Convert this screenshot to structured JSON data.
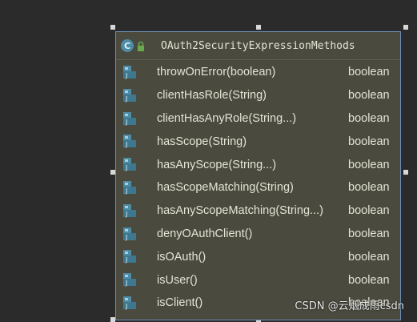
{
  "popup": {
    "title": "OAuth2SecurityExpressionMethods",
    "icons": {
      "class": "class-c-icon",
      "access": "lock-icon"
    },
    "class_icon_letter": "C",
    "method_icon": "method-j-icon",
    "methods": [
      {
        "name": "throwOnError(boolean)",
        "type": "boolean"
      },
      {
        "name": "clientHasRole(String)",
        "type": "boolean"
      },
      {
        "name": "clientHasAnyRole(String...)",
        "type": "boolean"
      },
      {
        "name": "hasScope(String)",
        "type": "boolean"
      },
      {
        "name": "hasAnyScope(String...)",
        "type": "boolean"
      },
      {
        "name": "hasScopeMatching(String)",
        "type": "boolean"
      },
      {
        "name": "hasAnyScopeMatching(String...)",
        "type": "boolean"
      },
      {
        "name": "denyOAuthClient()",
        "type": "boolean"
      },
      {
        "name": "isOAuth()",
        "type": "boolean"
      },
      {
        "name": "isUser()",
        "type": "boolean"
      },
      {
        "name": "isClient()",
        "type": "boolean"
      }
    ]
  },
  "watermark": "CSDN @云烟成雨csdn",
  "colors": {
    "background": "#2b2b2b",
    "popup_bg": "#4a4a3f",
    "popup_border": "#6b8db5",
    "text": "#e4e4d4",
    "method_icon": "#4e8ca6"
  }
}
